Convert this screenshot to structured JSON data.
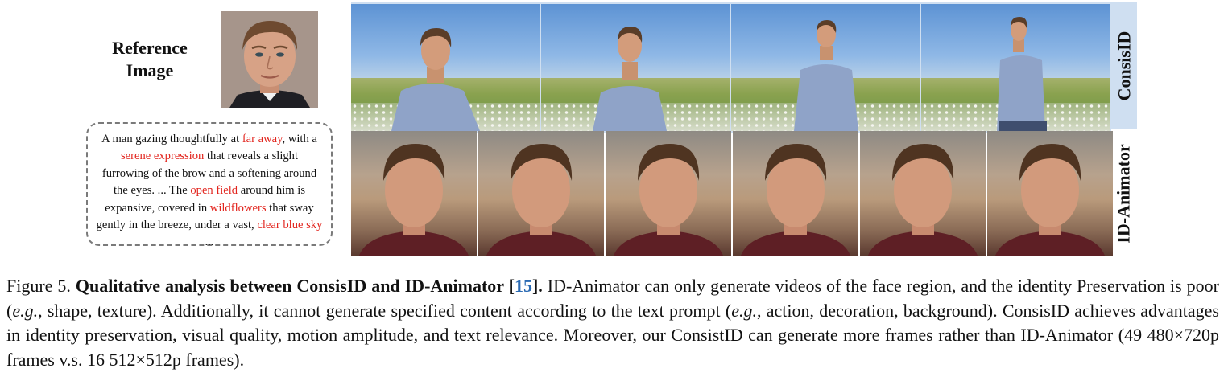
{
  "reference": {
    "label_line1": "Reference",
    "label_line2": "Image"
  },
  "prompt": {
    "p1": "A man gazing thoughtfully at ",
    "h1": "far away",
    "p2": ", with a ",
    "h2": "serene expression",
    "p3": " that reveals a slight furrowing of the brow and a softening around the eyes. ... The ",
    "h3": "open field",
    "p4": " around him is expansive, covered in ",
    "h4": "wildflowers",
    "p5": " that sway gently in the breeze, under a vast, ",
    "h5": "clear blue sky",
    "p6": " ..."
  },
  "rows": {
    "top_label": "ConsisID",
    "bottom_label": "ID-Animator"
  },
  "colors": {
    "highlight": "#e2251e",
    "label_band": "#cfdff1",
    "citation": "#2a6ab3"
  },
  "caption": {
    "lead": "Figure 5. ",
    "title": "Qualitative analysis between ConsisID and ID-Animator [",
    "ref": "15",
    "title_end": "].",
    "t1": " ID-Animator can only generate videos of the face region, and the identity Preservation is poor (",
    "eg1": "e.g.",
    "t2": ", shape, texture). Additionally, it cannot generate specified content according to the text prompt (",
    "eg2": "e.g.",
    "t3": ", action, decoration, background). ConsisID achieves advantages in identity preservation, visual quality, motion amplitude, and text relevance. Moreover, our ConsistID can generate more frames rather than ID-Animator (49 480×720p frames v.s. 16 512×512p frames)."
  }
}
